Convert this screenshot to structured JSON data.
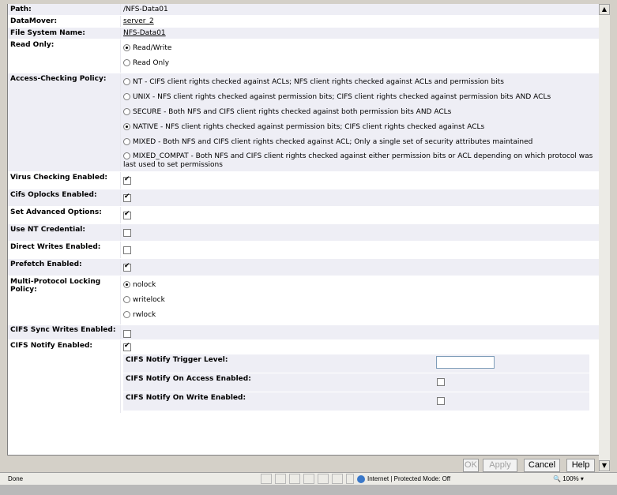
{
  "fields": {
    "path": {
      "label": "Path:",
      "value": "/NFS-Data01"
    },
    "datamover": {
      "label": "DataMover:",
      "value": "server_2"
    },
    "fsname": {
      "label": "File System Name:",
      "value": "NFS-Data01"
    },
    "readonly": {
      "label": "Read Only:",
      "options": [
        "Read/Write",
        "Read Only"
      ],
      "selected": "Read/Write"
    },
    "access": {
      "label": "Access-Checking Policy:",
      "options": [
        "NT - CIFS client rights checked against ACLs; NFS client rights checked against ACLs and permission bits",
        "UNIX - NFS client rights checked against permission bits; CIFS client rights checked against permission bits AND ACLs",
        "SECURE - Both NFS and CIFS client rights checked against both permission bits AND ACLs",
        "NATIVE - NFS client rights checked against permission bits; CIFS client rights checked against ACLs",
        "MIXED - Both NFS and CIFS client rights checked against ACL; Only a single set of security attributes maintained",
        "MIXED_COMPAT - Both NFS and CIFS client rights checked against either permission bits or ACL depending on which protocol was last used to set permissions"
      ],
      "selected": "NATIVE"
    },
    "virus": {
      "label": "Virus Checking Enabled:",
      "checked": true
    },
    "oplocks": {
      "label": "Cifs Oplocks Enabled:",
      "checked": true
    },
    "advanced": {
      "label": "Set Advanced Options:",
      "checked": true
    },
    "ntcred": {
      "label": "Use NT Credential:",
      "checked": false
    },
    "direct": {
      "label": "Direct Writes Enabled:",
      "checked": false
    },
    "prefetch": {
      "label": "Prefetch Enabled:",
      "checked": true
    },
    "locking": {
      "label": "Multi-Protocol Locking Policy:",
      "options": [
        "nolock",
        "writelock",
        "rwlock"
      ],
      "selected": "nolock"
    },
    "syncwrites": {
      "label": "CIFS Sync Writes Enabled:",
      "checked": false
    },
    "notify": {
      "label": "CIFS Notify Enabled:",
      "checked": true,
      "trigger_label": "CIFS Notify Trigger Level:",
      "trigger_value": "",
      "onaccess_label": "CIFS Notify On Access Enabled:",
      "onaccess_checked": false,
      "onwrite_label": "CIFS Notify On Write Enabled:",
      "onwrite_checked": false
    }
  },
  "buttons": {
    "ok": "OK",
    "apply": "Apply",
    "cancel": "Cancel",
    "help": "Help"
  },
  "statusbar": {
    "left": "Done",
    "zone": "Internet | Protected Mode: Off",
    "zoom": "100%"
  },
  "icons": {
    "scroll_up": "scroll-up-arrow",
    "scroll_down": "scroll-down-arrow",
    "globe": "globe-icon"
  }
}
